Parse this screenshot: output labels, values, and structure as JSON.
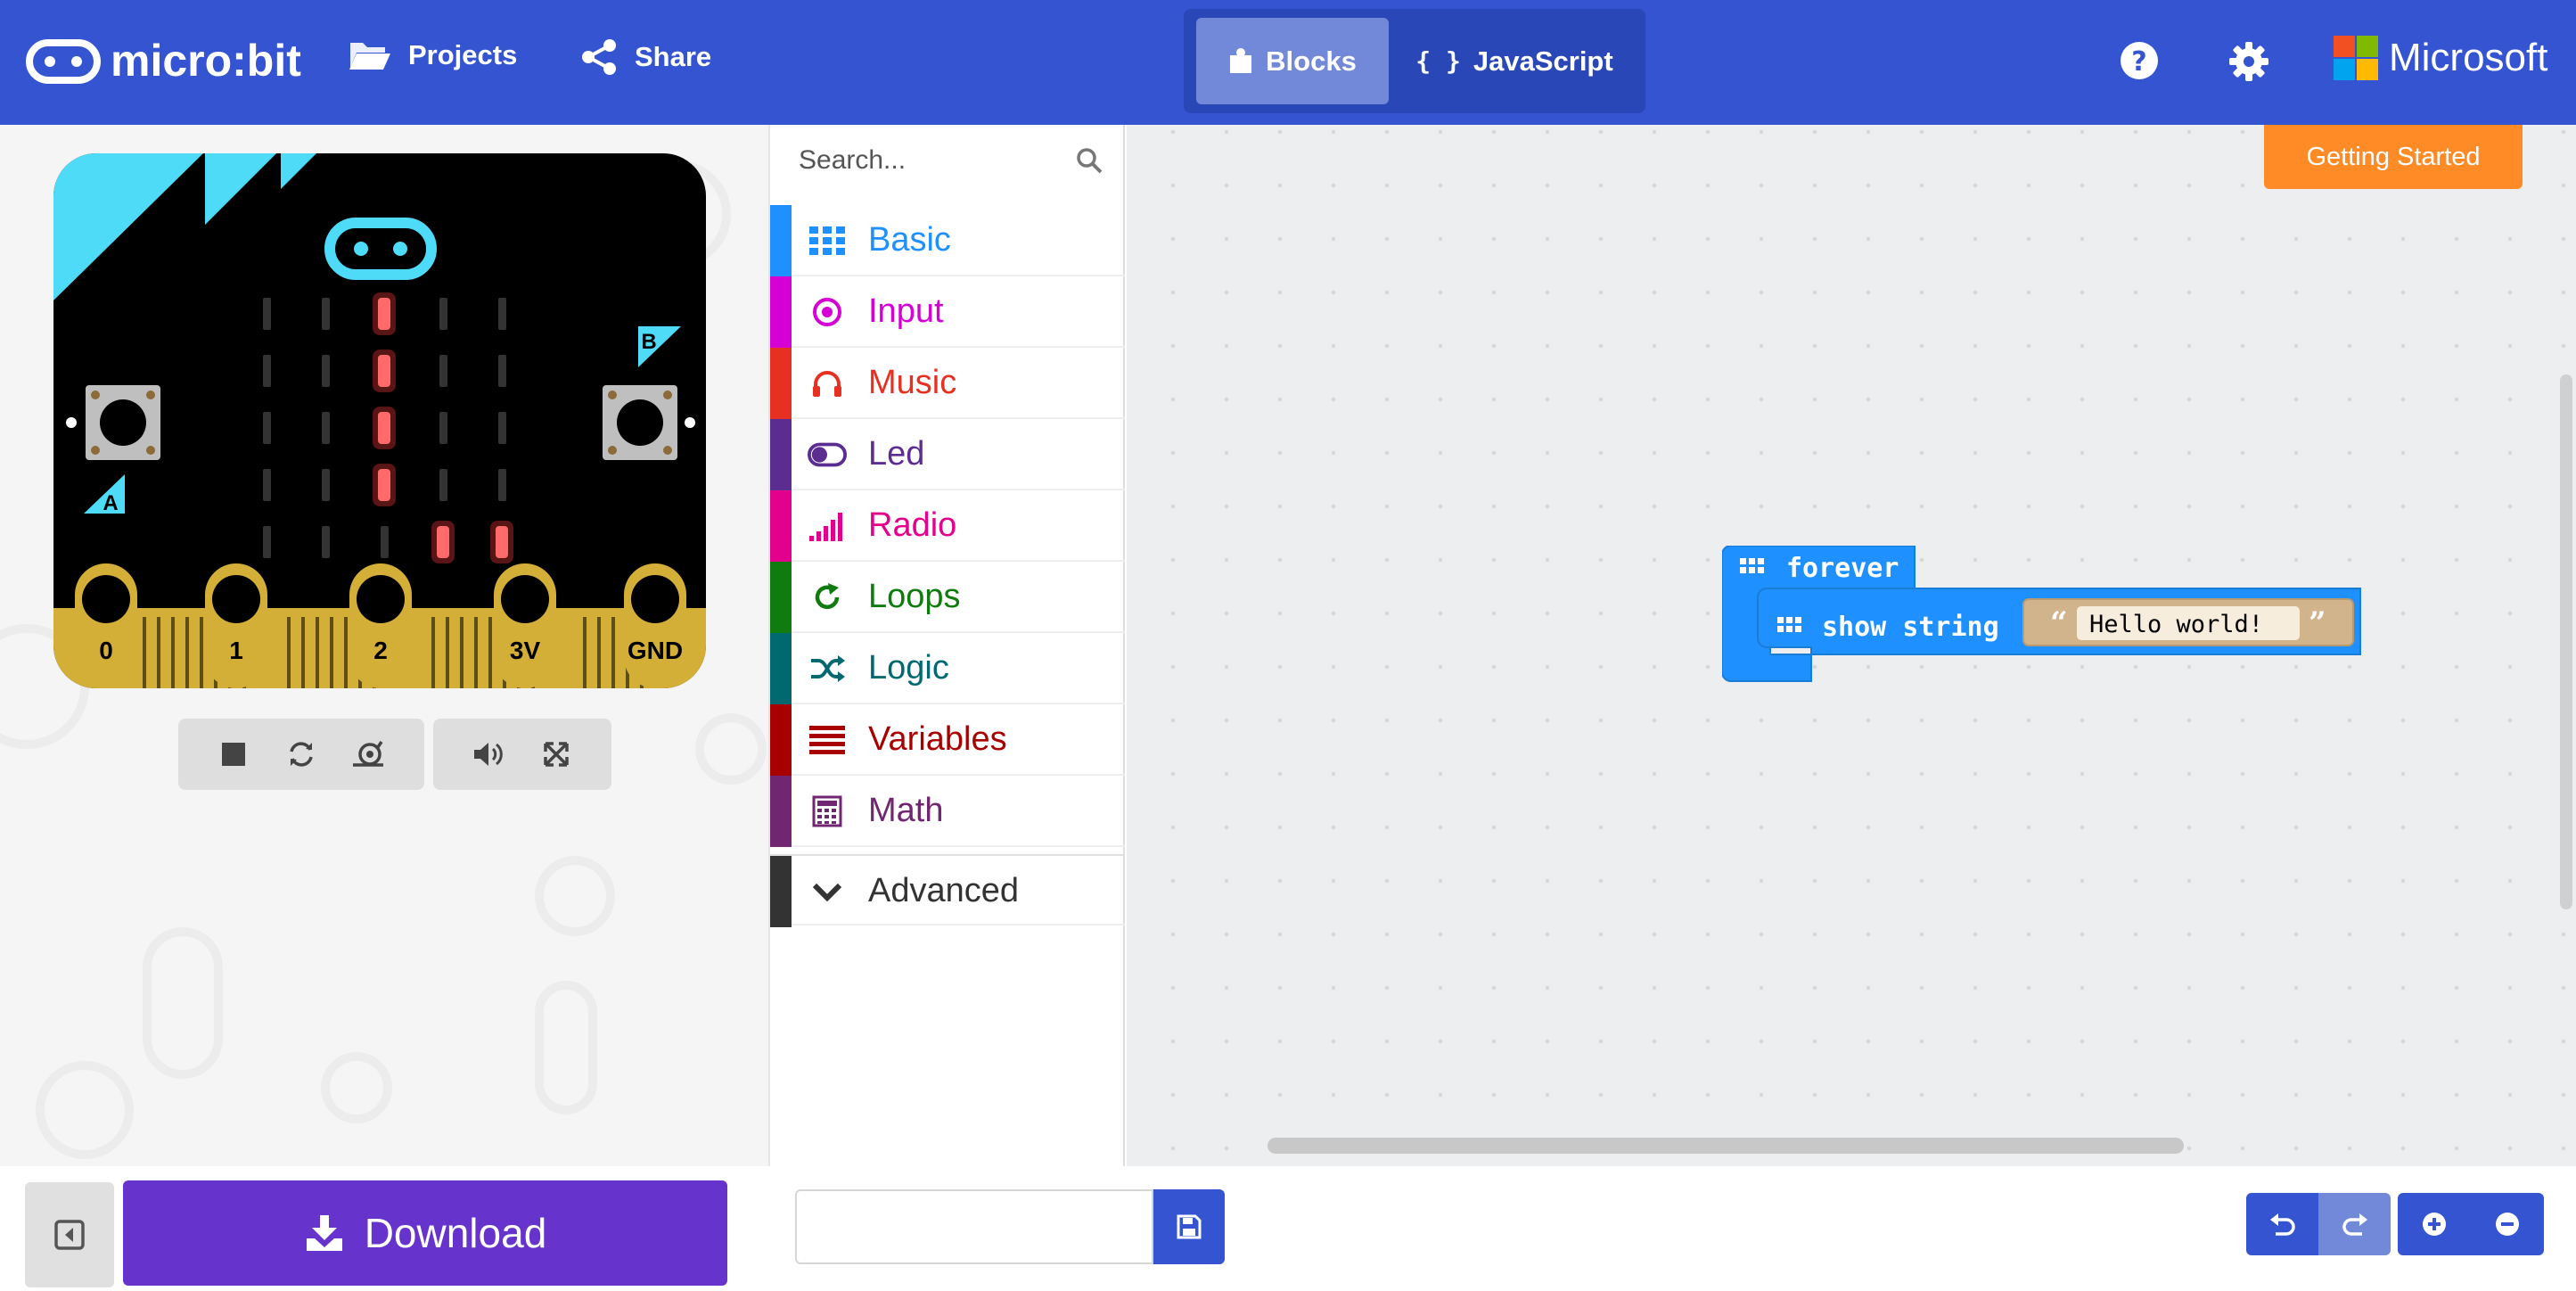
{
  "header": {
    "brand": "micro:bit",
    "projects_label": "Projects",
    "share_label": "Share",
    "tabs": {
      "blocks": "Blocks",
      "javascript": "JavaScript"
    },
    "microsoft_label": "Microsoft"
  },
  "simulator": {
    "pins": [
      "0",
      "1",
      "2",
      "3V",
      "GND"
    ],
    "button_a": "A",
    "button_b": "B",
    "led_matrix": [
      [
        0,
        0,
        1,
        0,
        0
      ],
      [
        0,
        0,
        1,
        0,
        0
      ],
      [
        0,
        0,
        1,
        0,
        0
      ],
      [
        0,
        0,
        1,
        0,
        0
      ],
      [
        0,
        0,
        0,
        1,
        1
      ]
    ],
    "controls": [
      "stop-icon",
      "restart-icon",
      "slow-mo-icon",
      "sound-icon",
      "fullscreen-icon"
    ]
  },
  "toolbox": {
    "search_placeholder": "Search...",
    "categories": [
      {
        "label": "Basic",
        "color": "#1E90FF"
      },
      {
        "label": "Input",
        "color": "#D400D4"
      },
      {
        "label": "Music",
        "color": "#E63022"
      },
      {
        "label": "Led",
        "color": "#5C2D91"
      },
      {
        "label": "Radio",
        "color": "#E3008C"
      },
      {
        "label": "Loops",
        "color": "#107C10"
      },
      {
        "label": "Logic",
        "color": "#006970"
      },
      {
        "label": "Variables",
        "color": "#A80000"
      },
      {
        "label": "Math",
        "color": "#712672"
      }
    ],
    "advanced_label": "Advanced"
  },
  "workspace": {
    "getting_started_label": "Getting Started",
    "blocks": {
      "forever_label": "forever",
      "show_string_label": "show string",
      "string_value": "Hello world!"
    }
  },
  "bottombar": {
    "download_label": "Download",
    "project_name_value": ""
  },
  "colors": {
    "header": "#3454D1",
    "download": "#6633CC",
    "getting_started": "#FF8B27",
    "basic_block": "#1E90FF",
    "string_block": "#D2B48C"
  }
}
